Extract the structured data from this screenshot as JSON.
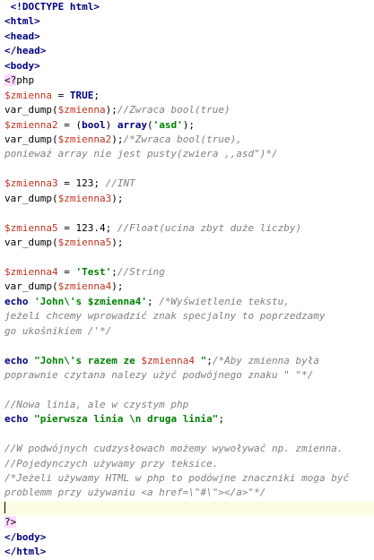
{
  "editor": {
    "current_line": 35,
    "colors": {
      "background": "#ffffff",
      "tag": "#000080",
      "variable": "#c0321e",
      "keyword": "#000080",
      "string": "#008000",
      "comment": "#808080",
      "php_tag_bg": "#ffd7ff",
      "current_line_bg": "#fdfde3"
    },
    "lines": [
      {
        "segments": [
          {
            "type": "tag",
            "text": " <!DOCTYPE html>"
          }
        ]
      },
      {
        "segments": [
          {
            "type": "tag",
            "text": "<html>"
          }
        ]
      },
      {
        "segments": [
          {
            "type": "tag",
            "text": "<head>"
          }
        ]
      },
      {
        "segments": [
          {
            "type": "tag",
            "text": "</head>"
          }
        ]
      },
      {
        "segments": [
          {
            "type": "tag",
            "text": "<body>"
          }
        ]
      },
      {
        "segments": [
          {
            "type": "phptag",
            "text": "<?"
          },
          {
            "type": "php",
            "text": "php"
          }
        ]
      },
      {
        "segments": [
          {
            "type": "var",
            "text": "$zmienna"
          },
          {
            "type": "plain",
            "text": " = "
          },
          {
            "type": "kw",
            "text": "TRUE"
          },
          {
            "type": "plain",
            "text": ";"
          }
        ]
      },
      {
        "segments": [
          {
            "type": "plain",
            "text": "var_dump("
          },
          {
            "type": "var",
            "text": "$zmienna"
          },
          {
            "type": "plain",
            "text": ");"
          },
          {
            "type": "com",
            "text": "//Zwraca bool(true)"
          }
        ]
      },
      {
        "segments": [
          {
            "type": "var",
            "text": "$zmienna2"
          },
          {
            "type": "plain",
            "text": " = ("
          },
          {
            "type": "kw",
            "text": "bool"
          },
          {
            "type": "plain",
            "text": ") "
          },
          {
            "type": "kw",
            "text": "array"
          },
          {
            "type": "plain",
            "text": "("
          },
          {
            "type": "str",
            "text": "'asd'"
          },
          {
            "type": "plain",
            "text": ");"
          }
        ]
      },
      {
        "segments": [
          {
            "type": "plain",
            "text": "var_dump("
          },
          {
            "type": "var",
            "text": "$zmienna2"
          },
          {
            "type": "plain",
            "text": ");"
          },
          {
            "type": "com",
            "text": "/*Zwraca bool(true),"
          }
        ]
      },
      {
        "segments": [
          {
            "type": "com",
            "text": "poniewaź array nie jest pusty(zwiera ,,asd\")*/"
          }
        ]
      },
      {
        "segments": []
      },
      {
        "segments": [
          {
            "type": "var",
            "text": "$zmienna3"
          },
          {
            "type": "plain",
            "text": " = 123; "
          },
          {
            "type": "com",
            "text": "//INT"
          }
        ]
      },
      {
        "segments": [
          {
            "type": "plain",
            "text": "var_dump("
          },
          {
            "type": "var",
            "text": "$zmienna3"
          },
          {
            "type": "plain",
            "text": ");"
          }
        ]
      },
      {
        "segments": []
      },
      {
        "segments": [
          {
            "type": "var",
            "text": "$zmienna5"
          },
          {
            "type": "plain",
            "text": " = 123.4; "
          },
          {
            "type": "com",
            "text": "//Float(ucina zbyt duże liczby)"
          }
        ]
      },
      {
        "segments": [
          {
            "type": "plain",
            "text": "var_dump("
          },
          {
            "type": "var",
            "text": "$zmienna5"
          },
          {
            "type": "plain",
            "text": ");"
          }
        ]
      },
      {
        "segments": []
      },
      {
        "segments": [
          {
            "type": "var",
            "text": "$zmienna4"
          },
          {
            "type": "plain",
            "text": " = "
          },
          {
            "type": "str",
            "text": "'Test'"
          },
          {
            "type": "plain",
            "text": ";"
          },
          {
            "type": "com",
            "text": "//String"
          }
        ]
      },
      {
        "segments": [
          {
            "type": "plain",
            "text": "var_dump("
          },
          {
            "type": "var",
            "text": "$zmienna4"
          },
          {
            "type": "plain",
            "text": ");"
          }
        ]
      },
      {
        "segments": [
          {
            "type": "kw",
            "text": "echo"
          },
          {
            "type": "plain",
            "text": " "
          },
          {
            "type": "str",
            "text": "'John\\'s $zmienna4'"
          },
          {
            "type": "plain",
            "text": "; "
          },
          {
            "type": "com",
            "text": "/*Wyświetlenie tekstu,"
          }
        ]
      },
      {
        "segments": [
          {
            "type": "com",
            "text": "jeżeli chcemy wprowadzić znak specjalny to poprzedzamy"
          }
        ]
      },
      {
        "segments": [
          {
            "type": "com",
            "text": "go ukośnikiem /'*/"
          }
        ]
      },
      {
        "segments": []
      },
      {
        "segments": [
          {
            "type": "kw",
            "text": "echo"
          },
          {
            "type": "plain",
            "text": " "
          },
          {
            "type": "str",
            "text": "\"John\\'s razem ze "
          },
          {
            "type": "var",
            "text": "$zmienna4"
          },
          {
            "type": "str",
            "text": " \""
          },
          {
            "type": "plain",
            "text": ";"
          },
          {
            "type": "com",
            "text": "/*Aby zmienna była"
          }
        ]
      },
      {
        "segments": [
          {
            "type": "com",
            "text": "poprawnie czytana nalezy użyć podwójnego znaku \" \"*/"
          }
        ]
      },
      {
        "segments": []
      },
      {
        "segments": [
          {
            "type": "com",
            "text": "//Nowa linia, ale w czystym php"
          }
        ]
      },
      {
        "segments": [
          {
            "type": "kw",
            "text": "echo"
          },
          {
            "type": "plain",
            "text": " "
          },
          {
            "type": "str",
            "text": "\"pierwsza linia \\n druga linia\""
          },
          {
            "type": "plain",
            "text": ";"
          }
        ]
      },
      {
        "segments": []
      },
      {
        "segments": [
          {
            "type": "com",
            "text": "//W podwójnych cudzysłowach możemy wywoływać np. zmienna."
          }
        ]
      },
      {
        "segments": [
          {
            "type": "com",
            "text": "//Pojedynczych używamy przy teksice."
          }
        ]
      },
      {
        "segments": [
          {
            "type": "com",
            "text": "/*Jeżeli używamy HTML w php to podówjne znaczniki moga być"
          }
        ]
      },
      {
        "segments": [
          {
            "type": "com",
            "text": "problemm przy używaniu <a href=\\\"#\\\"></a>\"*/"
          }
        ]
      },
      {
        "segments": []
      },
      {
        "segments": [
          {
            "type": "phptag",
            "text": "?>"
          }
        ]
      },
      {
        "segments": [
          {
            "type": "tag",
            "text": "</body>"
          }
        ]
      },
      {
        "segments": [
          {
            "type": "tag",
            "text": "</html>"
          }
        ]
      }
    ]
  }
}
